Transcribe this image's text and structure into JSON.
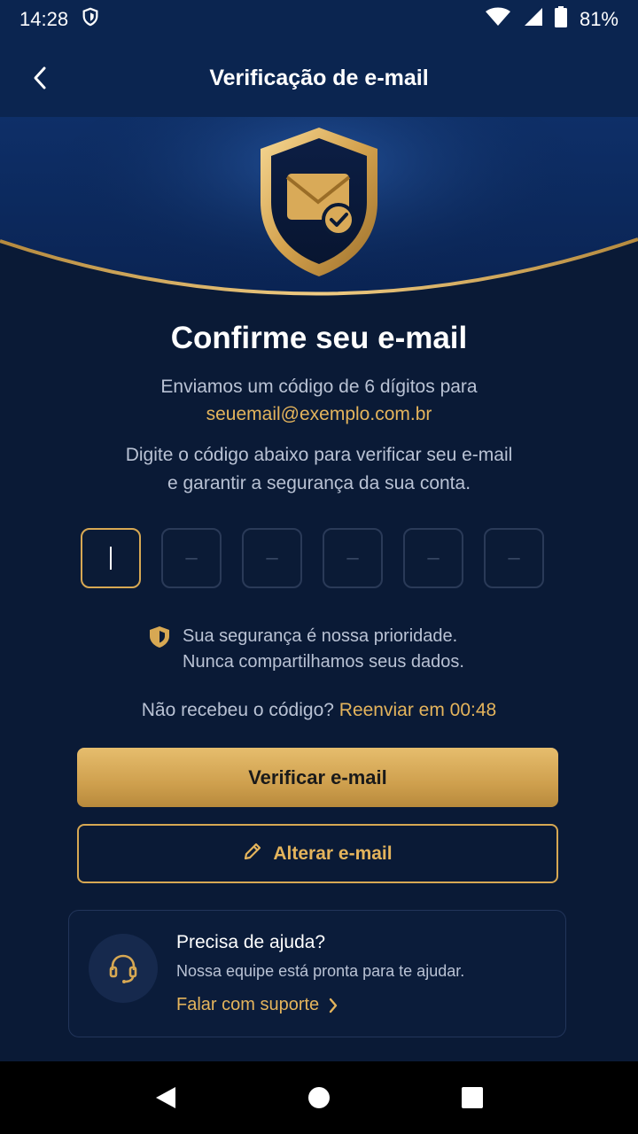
{
  "status": {
    "time": "14:28",
    "battery": "81%"
  },
  "app_bar": {
    "title": "Verificação de e-mail"
  },
  "main": {
    "heading": "Confirme seu e-mail",
    "sent_line": "Enviamos um código de 6 dígitos para",
    "email": "seuemail@exemplo.com.br",
    "instruction_1": "Digite o código abaixo para verificar seu e-mail",
    "instruction_2": "e garantir a segurança da sua conta.",
    "code_placeholder": "–",
    "security_1": "Sua segurança é nossa prioridade.",
    "security_2": "Nunca compartilhamos seus dados.",
    "resend_prefix": "Não recebeu o código?",
    "resend_link": "Reenviar em 00:48",
    "verify_button": "Verificar e-mail",
    "change_button": "Alterar e-mail"
  },
  "help": {
    "title": "Precisa de ajuda?",
    "description": "Nossa equipe está pronta para te ajudar.",
    "link": "Falar com suporte"
  },
  "colors": {
    "accent": "#d7a853",
    "background": "#0a1a36",
    "header": "#0b2550"
  }
}
